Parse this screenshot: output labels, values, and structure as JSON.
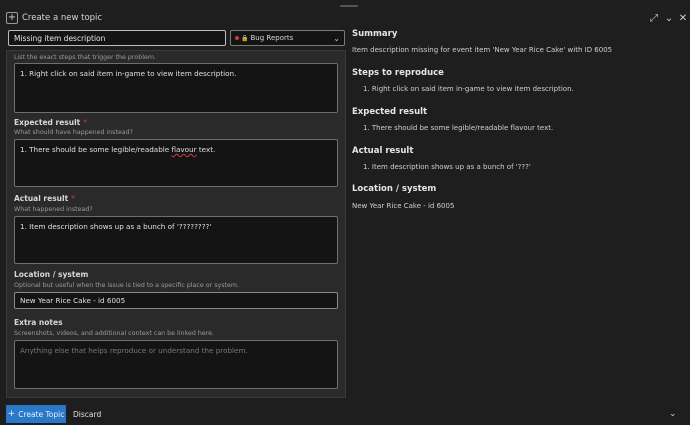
{
  "header": {
    "title": "Create a new topic",
    "plus_glyph": "+",
    "expand_glyph": "⤢",
    "minimize_glyph": "⌄",
    "close_glyph": "✕"
  },
  "editor": {
    "title_value": "Missing item description",
    "category": {
      "lock_glyph": "🔒",
      "label": "Bug Reports",
      "chevron": "⌄",
      "color": "#d03b3b"
    },
    "steps": {
      "help": "List the exact steps that trigger the problem.",
      "value": "1. Right click on said item in-game to view item description."
    },
    "expected": {
      "label": "Expected result",
      "required": "*",
      "help": "What should have happened instead?",
      "value_pre": "1. There should be some legible/readable ",
      "value_mis": "flavour",
      "value_post": " text."
    },
    "actual": {
      "label": "Actual result",
      "required": "*",
      "help": "What happened instead?",
      "value": "1. Item description shows up as a bunch of '????????'"
    },
    "location": {
      "label": "Location / system",
      "help": "Optional but useful when the issue is tied to a specific place or system.",
      "value": "New Year Rice Cake - id 6005"
    },
    "notes": {
      "label": "Extra notes",
      "help": "Screenshots, videos, and additional context can be linked here.",
      "placeholder": "Anything else that helps reproduce or understand the problem."
    }
  },
  "preview": {
    "summary_heading": "Summary",
    "summary_text": "Item description missing for event item 'New Year Rice Cake' with ID 6005",
    "steps_heading": "Steps to reproduce",
    "steps_item": "1.  Right click on said item in-game to view item description.",
    "expected_heading": "Expected result",
    "expected_item": "1.  There should be some legible/readable flavour text.",
    "actual_heading": "Actual result",
    "actual_item": "1.  Item description shows up as a bunch of '???'",
    "location_heading": "Location / system",
    "location_text": "New Year Rice Cake - id 6005"
  },
  "footer": {
    "create_plus": "+",
    "create_label": "Create Topic",
    "discard_label": "Discard",
    "collapse_glyph": "⌄"
  },
  "colors": {
    "accent": "#2a78c8",
    "required": "#d03b3b",
    "background": "#1e1e1e"
  }
}
